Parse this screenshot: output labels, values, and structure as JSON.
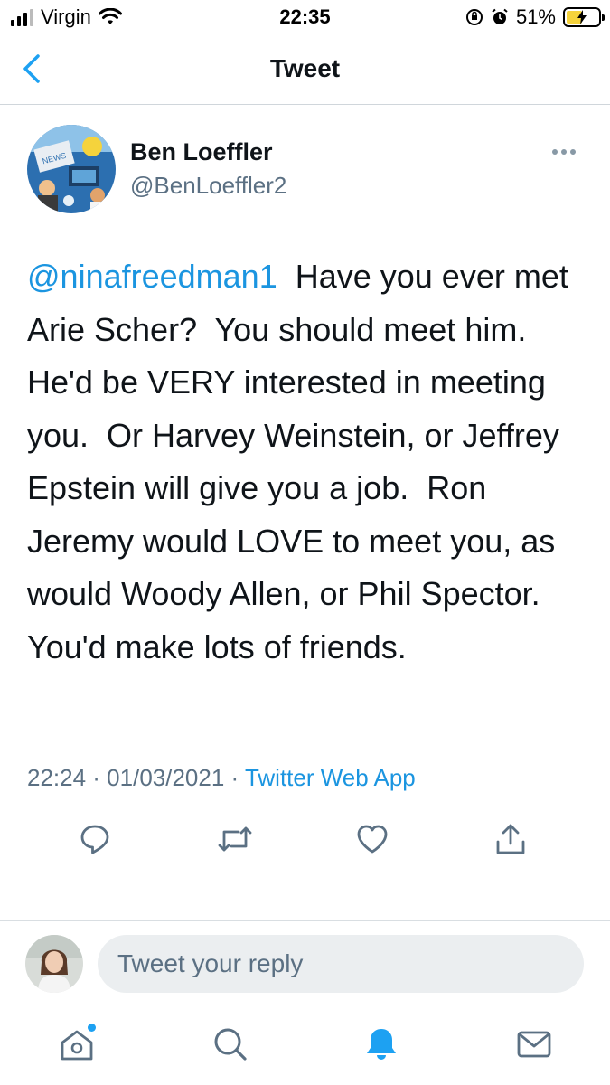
{
  "status_bar": {
    "carrier": "Virgin",
    "time": "22:35",
    "battery_percent": "51%",
    "battery_level": 0.51
  },
  "header": {
    "title": "Tweet"
  },
  "tweet": {
    "author_name": "Ben Loeffler",
    "author_handle": "@BenLoeffler2",
    "mention": "@ninafreedman1",
    "text": "  Have you ever met Arie Scher?  You should meet him.   He'd be VERY interested in meeting you.  Or Harvey Weinstein, or Jeffrey Epstein will give you a job.  Ron Jeremy would LOVE to meet you, as would Woody Allen, or Phil Spector.   You'd make lots of friends.",
    "timestamp": "22:24 · 01/03/2021 · ",
    "source": "Twitter Web App"
  },
  "reply": {
    "placeholder": "Tweet your reply"
  },
  "icons": {
    "back": "chevron-left-icon",
    "more": "more-dots-icon",
    "reply": "reply-icon",
    "retweet": "retweet-icon",
    "like": "heart-icon",
    "share": "share-icon",
    "home": "home-icon",
    "search": "search-icon",
    "notifications": "bell-icon",
    "messages": "mail-icon"
  },
  "colors": {
    "accent": "#1da1f2",
    "link": "#1b95e0",
    "secondary_text": "#5b7083",
    "battery_fill": "#f5d33c"
  }
}
